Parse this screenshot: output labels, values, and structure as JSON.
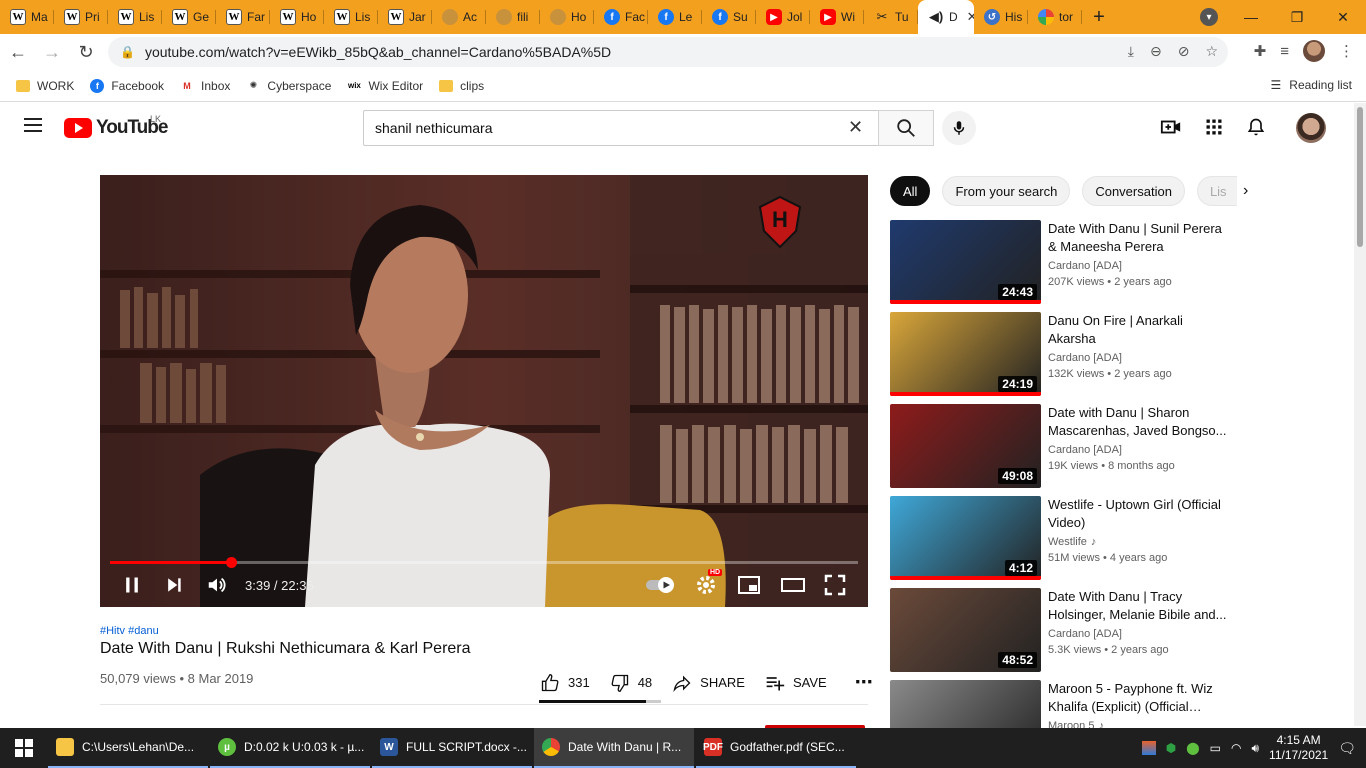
{
  "browser": {
    "tabs": [
      {
        "icon": "wikipedia-icon",
        "label": "Ma"
      },
      {
        "icon": "wikipedia-icon",
        "label": "Pri"
      },
      {
        "icon": "wikipedia-icon",
        "label": "Lis"
      },
      {
        "icon": "wikipedia-icon",
        "label": "Ge"
      },
      {
        "icon": "wikipedia-icon",
        "label": "Far"
      },
      {
        "icon": "wikipedia-icon",
        "label": "Ho"
      },
      {
        "icon": "wikipedia-icon",
        "label": "Lis"
      },
      {
        "icon": "wikipedia-icon",
        "label": "Jar"
      },
      {
        "icon": "bag-icon",
        "label": "Ac"
      },
      {
        "icon": "bag-icon",
        "label": "fili"
      },
      {
        "icon": "bag-icon",
        "label": "Ho"
      },
      {
        "icon": "facebook-icon",
        "label": "Fac"
      },
      {
        "icon": "facebook-icon",
        "label": "Le"
      },
      {
        "icon": "facebook-icon",
        "label": "Su"
      },
      {
        "icon": "youtube-icon",
        "label": "Jol"
      },
      {
        "icon": "youtube-icon",
        "label": "Wi"
      },
      {
        "icon": "tools-icon",
        "label": "Tu"
      },
      {
        "icon": "audio-icon",
        "label": "D",
        "active": true
      },
      {
        "icon": "history-icon",
        "label": "His"
      },
      {
        "icon": "google-icon",
        "label": "tor"
      }
    ],
    "url": "youtube.com/watch?v=eEWikb_85bQ&ab_channel=Cardano%5BADA%5D",
    "bookmarks": [
      {
        "icon": "folder-icon",
        "label": "WORK"
      },
      {
        "icon": "facebook-icon",
        "label": "Facebook"
      },
      {
        "icon": "gmail-icon",
        "label": "Inbox"
      },
      {
        "icon": "cyberspace-icon",
        "label": "Cyberspace"
      },
      {
        "icon": "wix-icon",
        "label": "Wix Editor"
      },
      {
        "icon": "folder-icon",
        "label": "clips"
      }
    ],
    "reading_list": "Reading list"
  },
  "youtube": {
    "logo_text": "YouTube",
    "country_code": "LK",
    "search": {
      "value": "shanil nethicumara"
    },
    "video": {
      "current_time": "3:39",
      "duration": "22:35",
      "time_display": "3:39 / 22:35",
      "progress": 0.162,
      "hashtags": "#Hitv #danu",
      "title": "Date With Danu | Rukshi Nethicumara & Karl Perera",
      "views": "50,079 views",
      "date": "8 Mar 2019",
      "meta": "50,079 views • 8 Mar 2019",
      "likes": "331",
      "dislikes": "48",
      "like_ratio": 0.873,
      "share_label": "SHARE",
      "save_label": "SAVE",
      "quality_badge": "HD",
      "channel_watermark": "Hitv"
    },
    "chips": [
      "All",
      "From your search",
      "Conversation",
      "Lis"
    ],
    "recommendations": [
      {
        "title": "Date With Danu | Sunil Perera & Maneesha Perera",
        "channel": "Cardano [ADA]",
        "stats": "207K views • 2 years ago",
        "duration": "24:43",
        "watched": 1.0,
        "thumb_color": "#1f3a6e"
      },
      {
        "title": "Danu On Fire | Anarkali Akarsha",
        "channel": "Cardano [ADA]",
        "stats": "132K views • 2 years ago",
        "duration": "24:19",
        "watched": 1.0,
        "thumb_color": "#d9a63a"
      },
      {
        "title": "Date with Danu | Sharon Mascarenhas, Javed Bongso...",
        "channel": "Cardano [ADA]",
        "stats": "19K views • 8 months ago",
        "duration": "49:08",
        "watched": 0.0,
        "thumb_color": "#8e1b1b"
      },
      {
        "title": "Westlife - Uptown Girl (Official Video)",
        "channel": "Westlife",
        "channel_icon": "music-note-icon",
        "stats": "51M views • 4 years ago",
        "duration": "4:12",
        "watched": 1.0,
        "thumb_color": "#3fa8d8"
      },
      {
        "title": "Date With Danu | Tracy Holsinger, Melanie Bibile and...",
        "channel": "Cardano [ADA]",
        "stats": "5.3K views • 2 years ago",
        "duration": "48:52",
        "watched": 0.0,
        "thumb_color": "#6b4a3a"
      },
      {
        "title": "Maroon 5 - Payphone ft. Wiz Khalifa (Explicit) (Official Musi...",
        "channel": "Maroon 5",
        "channel_icon": "music-note-icon",
        "stats": "",
        "duration": "",
        "watched": 0.0,
        "thumb_color": "#8a8a8a"
      }
    ]
  },
  "taskbar": {
    "items": [
      {
        "icon": "folder-icon",
        "label": "C:\\Users\\Lehan\\De...",
        "active": false
      },
      {
        "icon": "utorrent-icon",
        "label": "D:0.02 k U:0.03 k - µ...",
        "active": false
      },
      {
        "icon": "word-icon",
        "label": "FULL SCRIPT.docx -...",
        "active": false
      },
      {
        "icon": "chrome-icon",
        "label": "Date With Danu | R...",
        "active": true
      },
      {
        "icon": "pdf-icon",
        "label": "Godfather.pdf (SEC...",
        "active": false
      }
    ],
    "time": "4:15 AM",
    "date": "11/17/2021"
  },
  "colors": {
    "tabstrip": "#f3a01f",
    "youtube_red": "#ff0000",
    "link_blue": "#065fd4"
  }
}
